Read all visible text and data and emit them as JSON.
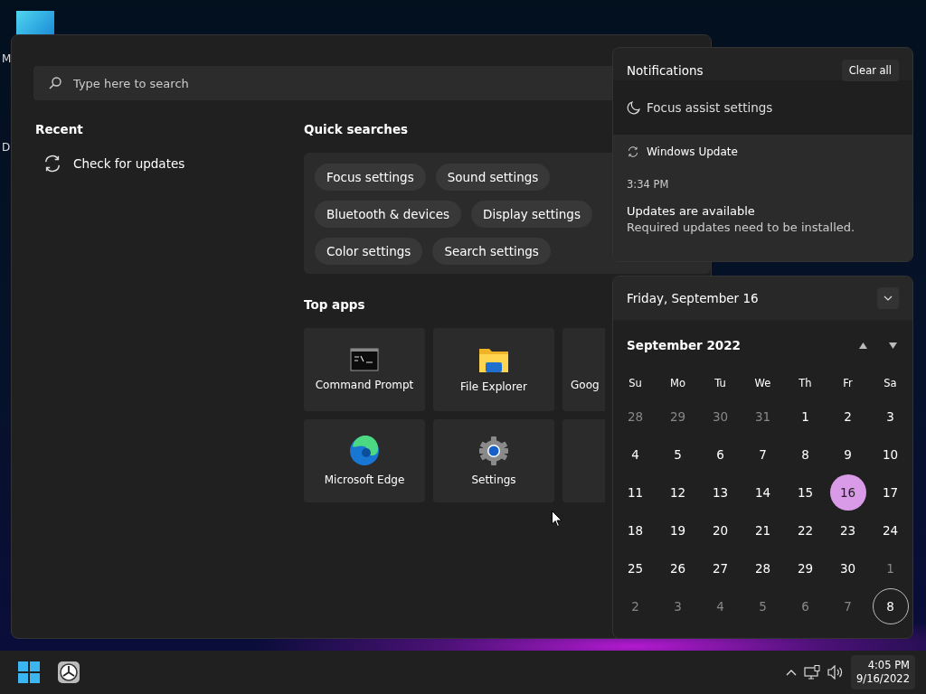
{
  "desktop": {
    "icon_labels": [
      "M",
      "D"
    ]
  },
  "start_menu": {
    "search": {
      "placeholder": "Type here to search"
    },
    "recent": {
      "title": "Recent",
      "items": [
        {
          "label": "Check for updates"
        }
      ]
    },
    "quick_searches": {
      "title": "Quick searches",
      "rows": [
        [
          "Focus settings",
          "Sound settings"
        ],
        [
          "Bluetooth & devices",
          "Display settings"
        ],
        [
          "Color settings",
          "Search settings"
        ]
      ]
    },
    "top_apps": {
      "title": "Top apps",
      "tiles": [
        {
          "kind": "cmd",
          "label": "Command Prompt"
        },
        {
          "kind": "folder",
          "label": "File Explorer"
        },
        {
          "kind": "partial",
          "label": "Goog"
        },
        {
          "kind": "edge",
          "label": "Microsoft Edge"
        },
        {
          "kind": "gear",
          "label": "Settings"
        },
        {
          "kind": "partial"
        }
      ]
    }
  },
  "notifications": {
    "title": "Notifications",
    "clear_button": "Clear all",
    "focus_assist": "Focus assist settings",
    "items": [
      {
        "app": "Windows Update",
        "time": "3:34 PM",
        "title": "Updates are available",
        "body": "Required updates need to be installed."
      }
    ]
  },
  "calendar": {
    "date_header": "Friday, September 16",
    "month": "September 2022",
    "weekdays": [
      "Su",
      "Mo",
      "Tu",
      "We",
      "Th",
      "Fr",
      "Sa"
    ],
    "weeks": [
      [
        {
          "day": "28",
          "muted": true,
          "selected": false
        },
        {
          "day": "29",
          "muted": true,
          "selected": false
        },
        {
          "day": "30",
          "muted": true,
          "selected": false
        },
        {
          "day": "31",
          "muted": true,
          "selected": false
        },
        {
          "day": "1",
          "muted": false,
          "selected": false
        },
        {
          "day": "2",
          "muted": false,
          "selected": false
        },
        {
          "day": "3",
          "muted": false,
          "selected": false
        }
      ],
      [
        {
          "day": "4",
          "muted": false,
          "selected": false
        },
        {
          "day": "5",
          "muted": false,
          "selected": false
        },
        {
          "day": "6",
          "muted": false,
          "selected": false
        },
        {
          "day": "7",
          "muted": false,
          "selected": false
        },
        {
          "day": "8",
          "muted": false,
          "selected": false
        },
        {
          "day": "9",
          "muted": false,
          "selected": false
        },
        {
          "day": "10",
          "muted": false,
          "selected": false
        }
      ],
      [
        {
          "day": "11",
          "muted": false,
          "selected": false
        },
        {
          "day": "12",
          "muted": false,
          "selected": false
        },
        {
          "day": "13",
          "muted": false,
          "selected": false
        },
        {
          "day": "14",
          "muted": false,
          "selected": false
        },
        {
          "day": "15",
          "muted": false,
          "selected": false
        },
        {
          "day": "16",
          "muted": false,
          "selected": true
        },
        {
          "day": "17",
          "muted": false,
          "selected": false
        }
      ],
      [
        {
          "day": "18",
          "muted": false,
          "selected": false
        },
        {
          "day": "19",
          "muted": false,
          "selected": false
        },
        {
          "day": "20",
          "muted": false,
          "selected": false
        },
        {
          "day": "21",
          "muted": false,
          "selected": false
        },
        {
          "day": "22",
          "muted": false,
          "selected": false
        },
        {
          "day": "23",
          "muted": false,
          "selected": false
        },
        {
          "day": "24",
          "muted": false,
          "selected": false
        }
      ],
      [
        {
          "day": "25",
          "muted": false,
          "selected": false
        },
        {
          "day": "26",
          "muted": false,
          "selected": false
        },
        {
          "day": "27",
          "muted": false,
          "selected": false
        },
        {
          "day": "28",
          "muted": false,
          "selected": false
        },
        {
          "day": "29",
          "muted": false,
          "selected": false
        },
        {
          "day": "30",
          "muted": false,
          "selected": false
        },
        {
          "day": "1",
          "muted": true,
          "selected": false
        }
      ],
      [
        {
          "day": "2",
          "muted": true,
          "selected": false
        },
        {
          "day": "3",
          "muted": true,
          "selected": false
        },
        {
          "day": "4",
          "muted": true,
          "selected": false
        },
        {
          "day": "5",
          "muted": true,
          "selected": false
        },
        {
          "day": "6",
          "muted": true,
          "selected": false
        },
        {
          "day": "7",
          "muted": true,
          "selected": false
        },
        {
          "day": "8",
          "muted": false,
          "selected": false,
          "focused": true
        }
      ]
    ]
  },
  "taskbar": {
    "time": "4:05 PM",
    "date": "9/16/2022"
  }
}
